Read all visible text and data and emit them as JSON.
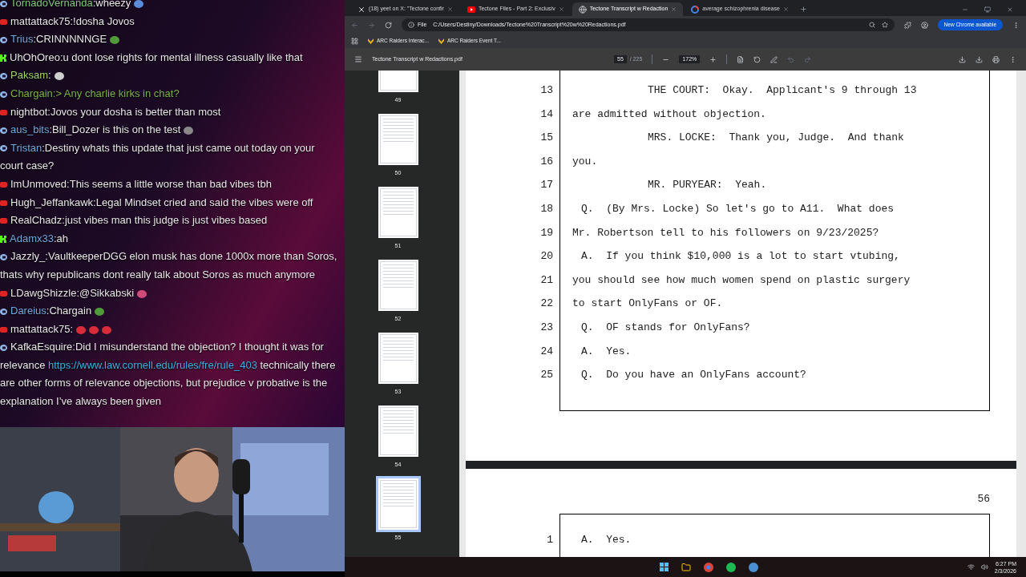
{
  "chat": {
    "messages": [
      {
        "badge": {
          "kind": "sub"
        },
        "user": "TornadoVernanda",
        "color": "#7ec87a",
        "text": ":wheezy",
        "emotes": [
          {
            "kind": "wings"
          }
        ],
        "greentext": false
      },
      {
        "badge": {
          "kind": "youtube"
        },
        "user": "mattattack75",
        "color": "#e6e6e6",
        "text": ":!dosha Jovos",
        "greentext": false
      },
      {
        "badge": {
          "kind": "sub"
        },
        "user": "Trius",
        "color": "#6fa8dc",
        "text": ":CRINNNNNGE",
        "emotes": [
          {
            "kind": "frog"
          }
        ],
        "greentext": false
      },
      {
        "badge": {
          "kind": "kick"
        },
        "user": "UhOhOreo",
        "color": "#e6e6e6",
        "text": ":u dont lose rights for mental illness casually like that",
        "greentext": false
      },
      {
        "badge": {
          "kind": "sub"
        },
        "user": "Paksam",
        "color": "#9ed36a",
        "text": ":",
        "emotes": [
          {
            "kind": "blob"
          }
        ],
        "greentext": false
      },
      {
        "badge": {
          "kind": "sub"
        },
        "user": "Chargain",
        "color": "#7bb34a",
        "text": ":> Any charlie kirks in chat?",
        "greentext": true
      },
      {
        "badge": {
          "kind": "youtube"
        },
        "user": "nightbot",
        "color": "#e6e6e6",
        "text": ":Jovos your dosha is better than most",
        "greentext": false
      },
      {
        "badge": {
          "kind": "sub"
        },
        "user": "aus_bits",
        "color": "#6fa8dc",
        "text": ":Bill_Dozer is this on the test",
        "emotes": [
          {
            "kind": "fin"
          }
        ],
        "greentext": false
      },
      {
        "badge": {
          "kind": "sub"
        },
        "user": "Tristan",
        "color": "#6fa8dc",
        "text": ":Destiny whats this update that just came out today on your court case?",
        "greentext": false
      },
      {
        "badge": {
          "kind": "youtube"
        },
        "user": "ImUnmoved",
        "color": "#e6e6e6",
        "text": ":This seems a little worse than bad vibes tbh",
        "greentext": false
      },
      {
        "badge": {
          "kind": "youtube"
        },
        "user": "Hugh_Jeffankawk",
        "color": "#e6e6e6",
        "text": ":Legal Mindset cried and said the vibes were off",
        "greentext": false
      },
      {
        "badge": {
          "kind": "youtube"
        },
        "user": "RealChadz",
        "color": "#e6e6e6",
        "text": ":just vibes man this judge is just vibes based",
        "greentext": false
      },
      {
        "badge": {
          "kind": "kick"
        },
        "user": "Adamx33",
        "color": "#6fa8dc",
        "text": ":ah",
        "greentext": false
      },
      {
        "badge": {
          "kind": "sub"
        },
        "user": "Jazzly_",
        "color": "#e6e6e6",
        "text": ":VaultkeeperDGG elon musk has done 1000x more than Soros, thats why republicans dont really talk about Soros as much anymore",
        "greentext": false
      },
      {
        "badge": {
          "kind": "youtube"
        },
        "user": "LDawgShizzle",
        "color": "#e6e6e6",
        "text": ":@Sikkabski",
        "emotes": [
          {
            "kind": "heart"
          }
        ],
        "greentext": false
      },
      {
        "badge": {
          "kind": "sub"
        },
        "user": "Dareius",
        "color": "#6fa8dc",
        "text": ":Chargain",
        "emotes": [
          {
            "kind": "frog"
          }
        ],
        "greentext": false
      },
      {
        "badge": {
          "kind": "youtube"
        },
        "user": "mattattack75",
        "color": "#e6e6e6",
        "text": ":",
        "emotes": [
          {
            "kind": "red"
          },
          {
            "kind": "red"
          },
          {
            "kind": "red"
          }
        ],
        "greentext": false
      },
      {
        "badge": {
          "kind": "sub"
        },
        "user": "KafkaEsquire",
        "color": "#e6e6e6",
        "text": ":Did I misunderstand the objection? I thought it was for relevance",
        "link": "https://www.law.cornell.edu/rules/fre/rule_403",
        "text_after": "technically there are other forms of relevance objections, but prejudice v probative is the explanation I’ve always been given",
        "greentext": false
      }
    ]
  },
  "browser": {
    "tabs": [
      {
        "kind": "x",
        "title": "(18) yeet on X: \"Tectone confir",
        "selected": false
      },
      {
        "kind": "video",
        "title": "Tectone Files - Part 2: Exclusiv",
        "selected": false
      },
      {
        "kind": "globe",
        "title": "Tectone Transcript w Redaction",
        "selected": true
      },
      {
        "kind": "google",
        "title": "average schizophrenia disease",
        "selected": false
      }
    ],
    "address": {
      "scheme": "File",
      "url": "C:/Users/Destiny/Downloads/Tectone%20Transcript%20w%20Redactions.pdf"
    },
    "update_button": "New Chrome available",
    "bookmarks": [
      "ARC Raiders Interac...",
      "ARC Raiders Event T..."
    ]
  },
  "pdf": {
    "title": "Tectone Transcript w Redactions.pdf",
    "page": "55",
    "page_count": "/ 225",
    "zoom": "172%",
    "thumbnails": [
      {
        "label": "49",
        "selected": false
      },
      {
        "label": "50",
        "selected": false
      },
      {
        "label": "51",
        "selected": false
      },
      {
        "label": "52",
        "selected": false
      },
      {
        "label": "53",
        "selected": false
      },
      {
        "label": "54",
        "selected": false
      },
      {
        "label": "55",
        "selected": true
      }
    ],
    "page_lines": [
      {
        "num": "13",
        "kind": "speaker",
        "text": "THE COURT:  Okay.  Applicant's 9 through 13"
      },
      {
        "num": "14",
        "kind": "cont",
        "text": "are admitted without objection."
      },
      {
        "num": "15",
        "kind": "speaker",
        "text": "MRS. LOCKE:  Thank you, Judge.  And thank"
      },
      {
        "num": "16",
        "kind": "cont",
        "text": "you."
      },
      {
        "num": "17",
        "kind": "speaker",
        "text": "MR. PURYEAR:  Yeah."
      },
      {
        "num": "18",
        "kind": "qa",
        "text": "Q.  (By Mrs. Locke) So let's go to A11.  What does"
      },
      {
        "num": "19",
        "kind": "cont",
        "text": "Mr. Robertson tell to his followers on 9/23/2025?"
      },
      {
        "num": "20",
        "kind": "qa",
        "text": "A.  If you think $10,000 is a lot to start vtubing,"
      },
      {
        "num": "21",
        "kind": "cont",
        "text": "you should see how much women spend on plastic surgery"
      },
      {
        "num": "22",
        "kind": "cont",
        "text": "to start OnlyFans or OF."
      },
      {
        "num": "23",
        "kind": "qa",
        "text": "Q.  OF stands for OnlyFans?"
      },
      {
        "num": "24",
        "kind": "qa",
        "text": "A.  Yes."
      },
      {
        "num": "25",
        "kind": "qa",
        "text": "Q.  Do you have an OnlyFans account?"
      }
    ],
    "next_page": {
      "number": "56",
      "lines": [
        {
          "num": "1",
          "kind": "qa",
          "text": "A.  Yes."
        }
      ]
    }
  },
  "taskbar": {
    "time": "6:27 PM",
    "date": "2/3/2026"
  }
}
